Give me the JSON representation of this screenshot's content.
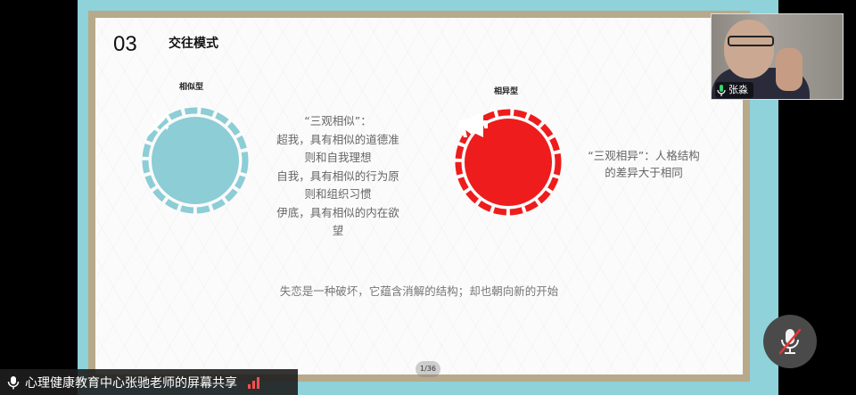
{
  "slide": {
    "section_number": "03",
    "section_title": "交往模式",
    "left": {
      "label": "相似型",
      "icon": "magic-wand-icon",
      "color": "#8ccdd6",
      "lines": [
        "“三观相似”：",
        "超我，具有相似的道德准",
        "则和自我理想",
        "自我，具有相似的行为原",
        "则和组织习惯",
        "伊底，具有相似的内在欲",
        "望"
      ]
    },
    "right": {
      "label": "相异型",
      "icon": "megaphone-icon",
      "color": "#ee1c1c",
      "lines": [
        "“三观相异”：人格结构",
        "的差异大于相同"
      ]
    },
    "footer": "失恋是一种破坏，它蕴含消解的结构；却也朝向新的开始",
    "page_indicator": "1/36"
  },
  "video": {
    "name": "张淼"
  },
  "share_bar": {
    "text": "心理健康教育中心张驰老师的屏幕共享"
  },
  "colors": {
    "stage_bg": "#8fd2da",
    "frame": "#b8a98b",
    "signal": "#ff4d4d"
  }
}
